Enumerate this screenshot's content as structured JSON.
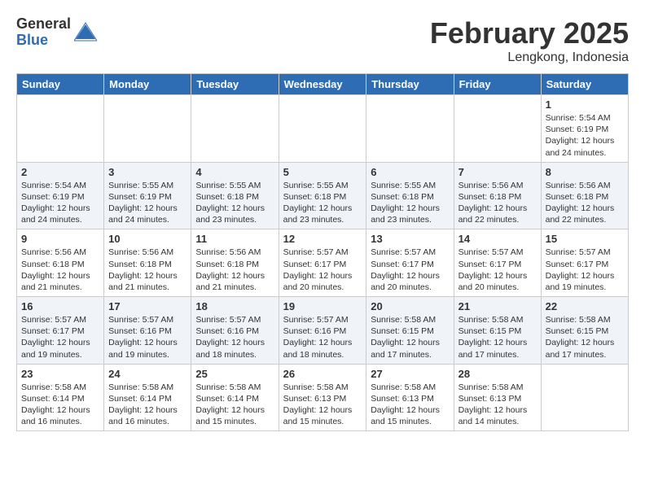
{
  "header": {
    "logo_general": "General",
    "logo_blue": "Blue",
    "month_title": "February 2025",
    "subtitle": "Lengkong, Indonesia"
  },
  "days_of_week": [
    "Sunday",
    "Monday",
    "Tuesday",
    "Wednesday",
    "Thursday",
    "Friday",
    "Saturday"
  ],
  "weeks": [
    [
      {
        "day": "",
        "detail": ""
      },
      {
        "day": "",
        "detail": ""
      },
      {
        "day": "",
        "detail": ""
      },
      {
        "day": "",
        "detail": ""
      },
      {
        "day": "",
        "detail": ""
      },
      {
        "day": "",
        "detail": ""
      },
      {
        "day": "1",
        "detail": "Sunrise: 5:54 AM\nSunset: 6:19 PM\nDaylight: 12 hours\nand 24 minutes."
      }
    ],
    [
      {
        "day": "2",
        "detail": "Sunrise: 5:54 AM\nSunset: 6:19 PM\nDaylight: 12 hours\nand 24 minutes."
      },
      {
        "day": "3",
        "detail": "Sunrise: 5:55 AM\nSunset: 6:19 PM\nDaylight: 12 hours\nand 24 minutes."
      },
      {
        "day": "4",
        "detail": "Sunrise: 5:55 AM\nSunset: 6:18 PM\nDaylight: 12 hours\nand 23 minutes."
      },
      {
        "day": "5",
        "detail": "Sunrise: 5:55 AM\nSunset: 6:18 PM\nDaylight: 12 hours\nand 23 minutes."
      },
      {
        "day": "6",
        "detail": "Sunrise: 5:55 AM\nSunset: 6:18 PM\nDaylight: 12 hours\nand 23 minutes."
      },
      {
        "day": "7",
        "detail": "Sunrise: 5:56 AM\nSunset: 6:18 PM\nDaylight: 12 hours\nand 22 minutes."
      },
      {
        "day": "8",
        "detail": "Sunrise: 5:56 AM\nSunset: 6:18 PM\nDaylight: 12 hours\nand 22 minutes."
      }
    ],
    [
      {
        "day": "9",
        "detail": "Sunrise: 5:56 AM\nSunset: 6:18 PM\nDaylight: 12 hours\nand 21 minutes."
      },
      {
        "day": "10",
        "detail": "Sunrise: 5:56 AM\nSunset: 6:18 PM\nDaylight: 12 hours\nand 21 minutes."
      },
      {
        "day": "11",
        "detail": "Sunrise: 5:56 AM\nSunset: 6:18 PM\nDaylight: 12 hours\nand 21 minutes."
      },
      {
        "day": "12",
        "detail": "Sunrise: 5:57 AM\nSunset: 6:17 PM\nDaylight: 12 hours\nand 20 minutes."
      },
      {
        "day": "13",
        "detail": "Sunrise: 5:57 AM\nSunset: 6:17 PM\nDaylight: 12 hours\nand 20 minutes."
      },
      {
        "day": "14",
        "detail": "Sunrise: 5:57 AM\nSunset: 6:17 PM\nDaylight: 12 hours\nand 20 minutes."
      },
      {
        "day": "15",
        "detail": "Sunrise: 5:57 AM\nSunset: 6:17 PM\nDaylight: 12 hours\nand 19 minutes."
      }
    ],
    [
      {
        "day": "16",
        "detail": "Sunrise: 5:57 AM\nSunset: 6:17 PM\nDaylight: 12 hours\nand 19 minutes."
      },
      {
        "day": "17",
        "detail": "Sunrise: 5:57 AM\nSunset: 6:16 PM\nDaylight: 12 hours\nand 19 minutes."
      },
      {
        "day": "18",
        "detail": "Sunrise: 5:57 AM\nSunset: 6:16 PM\nDaylight: 12 hours\nand 18 minutes."
      },
      {
        "day": "19",
        "detail": "Sunrise: 5:57 AM\nSunset: 6:16 PM\nDaylight: 12 hours\nand 18 minutes."
      },
      {
        "day": "20",
        "detail": "Sunrise: 5:58 AM\nSunset: 6:15 PM\nDaylight: 12 hours\nand 17 minutes."
      },
      {
        "day": "21",
        "detail": "Sunrise: 5:58 AM\nSunset: 6:15 PM\nDaylight: 12 hours\nand 17 minutes."
      },
      {
        "day": "22",
        "detail": "Sunrise: 5:58 AM\nSunset: 6:15 PM\nDaylight: 12 hours\nand 17 minutes."
      }
    ],
    [
      {
        "day": "23",
        "detail": "Sunrise: 5:58 AM\nSunset: 6:14 PM\nDaylight: 12 hours\nand 16 minutes."
      },
      {
        "day": "24",
        "detail": "Sunrise: 5:58 AM\nSunset: 6:14 PM\nDaylight: 12 hours\nand 16 minutes."
      },
      {
        "day": "25",
        "detail": "Sunrise: 5:58 AM\nSunset: 6:14 PM\nDaylight: 12 hours\nand 15 minutes."
      },
      {
        "day": "26",
        "detail": "Sunrise: 5:58 AM\nSunset: 6:13 PM\nDaylight: 12 hours\nand 15 minutes."
      },
      {
        "day": "27",
        "detail": "Sunrise: 5:58 AM\nSunset: 6:13 PM\nDaylight: 12 hours\nand 15 minutes."
      },
      {
        "day": "28",
        "detail": "Sunrise: 5:58 AM\nSunset: 6:13 PM\nDaylight: 12 hours\nand 14 minutes."
      },
      {
        "day": "",
        "detail": ""
      }
    ]
  ]
}
